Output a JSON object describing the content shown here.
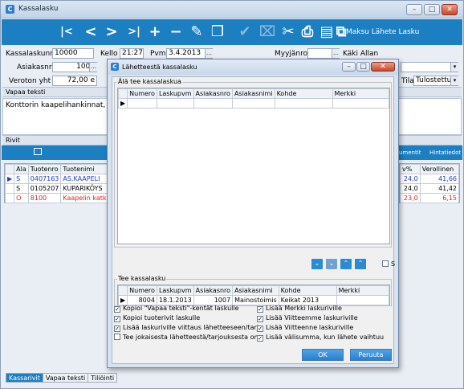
{
  "window": {
    "title": "Kassalasku"
  },
  "toolbar": {
    "buttons": [
      {
        "name": "first-record-button",
        "glyph": "|<"
      },
      {
        "name": "previous-record-button",
        "glyph": "<"
      },
      {
        "name": "next-record-button",
        "glyph": ">"
      },
      {
        "name": "last-record-button",
        "glyph": ">|"
      },
      {
        "name": "add-button",
        "glyph": "+"
      },
      {
        "name": "delete-button",
        "glyph": "−"
      },
      {
        "name": "edit-button",
        "glyph": "✎"
      },
      {
        "name": "copy-button",
        "glyph": "❐"
      },
      {
        "name": "save-button",
        "glyph": "✔"
      },
      {
        "name": "cancel-button",
        "glyph": "⌧"
      },
      {
        "name": "tools-button",
        "glyph": "✂"
      },
      {
        "name": "print-button",
        "glyph": "⎙"
      },
      {
        "name": "report-button",
        "glyph": "▤"
      },
      {
        "name": "copies-button",
        "glyph": "⧉"
      }
    ],
    "pay_send_label": "Maksu Lähete Lasku"
  },
  "form": {
    "invoice_no_label": "Kassalaskunro",
    "invoice_no_value": "10000",
    "time_label": "Kello",
    "time_value": "21:27",
    "date_label": "Pvm",
    "date_value": "3.4.2013",
    "seller_label": "Myyjänro",
    "seller_value": "3",
    "seller_name": "Käki Allan",
    "customer_label": "Asiakasnro",
    "customer_value": "1001",
    "tax_free_label": "Veroton yht",
    "tax_free_value": "72,00 e",
    "status_label": "Tila",
    "status_value": "Tulostettu"
  },
  "free_text": {
    "header": "Vapaa teksti",
    "content": "Konttorin kaapelihankinnat, , K"
  },
  "rows": {
    "header": "Rivit",
    "document_label": "umentit",
    "price_info_label": "Hintatiedot",
    "columns": [
      "Ala",
      "Tuotenro",
      "Tuotenimi"
    ],
    "right_columns": [
      "v%",
      "Verollinen"
    ],
    "items": [
      {
        "marker": "▶",
        "ala": "S",
        "code": "0407163",
        "name": "AS.KAAPELI",
        "vat": "24,0",
        "gross": "41,66",
        "color": "#1a3fd0"
      },
      {
        "marker": "",
        "ala": "S",
        "code": "0105207",
        "name": "KUPARIKÖYS",
        "vat": "24,0",
        "gross": "41,42",
        "color": "#000000"
      },
      {
        "marker": "",
        "ala": "O",
        "code": "8100",
        "name": "Kaapelin katk",
        "vat": "23,0",
        "gross": "6,15",
        "color": "#e02020"
      }
    ]
  },
  "tabs": [
    "Kassarivit",
    "Vapaa teksti",
    "Tiliöinti"
  ],
  "dialog": {
    "title": "Lähetteestä kassalasku",
    "source_group": "Älä tee kassalaskua",
    "target_group": "Tee kassalasku",
    "columns": [
      "Numero",
      "Laskupvm",
      "Asiakasnro",
      "Asiakasnimi",
      "Kohde",
      "Merkki"
    ],
    "source_rows": [],
    "target_rows": [
      {
        "number": "8004",
        "date": "18.1.2013",
        "customer_no": "1007",
        "customer_name": "Mainostoimis",
        "target": "Keikat 2013",
        "mark": ""
      }
    ],
    "select_all_label": "S",
    "options_left": [
      {
        "label": "Kopioi \"Vapaa teksti\"-kentät laskulle",
        "checked": true
      },
      {
        "label": "Kopioi tuoterivit laskulle",
        "checked": true
      },
      {
        "label": "Lisää laskuriville viittaus lähetteeseen/tarjo",
        "checked": true
      },
      {
        "label": "Tee jokaisesta lähetteestä/tarjouksesta om",
        "checked": false
      }
    ],
    "options_right": [
      {
        "label": "Lisää Merkki laskuriville",
        "checked": true
      },
      {
        "label": "Lisää Viitteemme laskuriville",
        "checked": true
      },
      {
        "label": "Lisää Viitteenne laskuriville",
        "checked": true
      },
      {
        "label": "Lisää välisumma, kun lähete vaihtuu",
        "checked": true
      }
    ],
    "ok_label": "OK",
    "cancel_label": "Peruuta"
  }
}
